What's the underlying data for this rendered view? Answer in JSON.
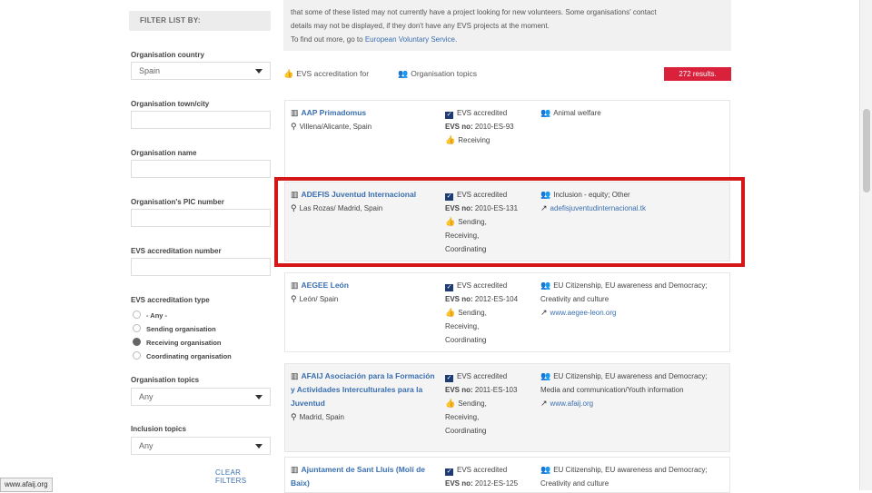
{
  "sidebar": {
    "header": "FILTER LIST BY:",
    "country_label": "Organisation country",
    "country_value": "Spain",
    "town_label": "Organisation town/city",
    "name_label": "Organisation name",
    "pic_label": "Organisation's PIC number",
    "evs_label": "EVS accreditation number",
    "type_label": "EVS accreditation type",
    "type_options": [
      {
        "label": "- Any -",
        "selected": false
      },
      {
        "label": "Sending organisation",
        "selected": false
      },
      {
        "label": "Receiving organisation",
        "selected": true
      },
      {
        "label": "Coordinating organisation",
        "selected": false
      }
    ],
    "topics_label": "Organisation topics",
    "topics_value": "Any",
    "inclusion_label": "Inclusion topics",
    "inclusion_value": "Any",
    "clear_filters": "CLEAR FILTERS"
  },
  "info": {
    "line1": "that some of these listed may not currently have a project looking for new volunteers. Some organisations' contact",
    "line2": "details may not be displayed, if they don't have any EVS projects at the moment.",
    "line3_prefix": "To find out more, go to ",
    "line3_link": "European Voluntary Service",
    "line3_suffix": "."
  },
  "tabs": {
    "tab1": "EVS accreditation for",
    "tab2": "Organisation topics",
    "results": "272 results."
  },
  "orgs": [
    {
      "name": "AAP Primadomus",
      "location": "Villena/Alicante, Spain",
      "accredited": "EVS accredited",
      "evs_no_label": "EVS no:",
      "evs_no": "2010-ES-93",
      "roles": [
        "Receiving"
      ],
      "topics": "Animal welfare",
      "url": ""
    },
    {
      "name": "ADEFIS Juventud Internacional",
      "location": "Las Rozas/ Madrid, Spain",
      "accredited": "EVS accredited",
      "evs_no_label": "EVS no:",
      "evs_no": "2010-ES-131",
      "roles": [
        "Sending,",
        "Receiving,",
        "Coordinating"
      ],
      "topics": "Inclusion - equity; Other",
      "url": "adefisjuventudinternacional.tk"
    },
    {
      "name": "AEGEE León",
      "location": "León/ Spain",
      "accredited": "EVS accredited",
      "evs_no_label": "EVS no:",
      "evs_no": "2012-ES-104",
      "roles": [
        "Sending,",
        "Receiving,",
        "Coordinating"
      ],
      "topics": "EU Citizenship, EU awareness and Democracy; Creativity and culture",
      "url": "www.aegee-leon.org"
    },
    {
      "name": "AFAIJ Asociación para la Formación y Actividades Interculturales para la Juventud",
      "location": "Madrid, Spain",
      "accredited": "EVS accredited",
      "evs_no_label": "EVS no:",
      "evs_no": "2011-ES-103",
      "roles": [
        "Sending,",
        "Receiving,",
        "Coordinating"
      ],
      "topics": "EU Citizenship, EU awareness and Democracy; Media and communication/Youth information",
      "url": "www.afaij.org"
    },
    {
      "name": "Ajuntament de Sant Lluís (Molí de Baix)",
      "location": "",
      "accredited": "EVS accredited",
      "evs_no_label": "EVS no:",
      "evs_no": "2012-ES-125",
      "roles": [],
      "topics": "EU Citizenship, EU awareness and Democracy; Creativity and culture",
      "url": ""
    }
  ],
  "status_url": "www.afaij.org",
  "colors": {
    "accent": "#d9213b",
    "link": "#3a6fb0",
    "highlight": "#d61717"
  }
}
